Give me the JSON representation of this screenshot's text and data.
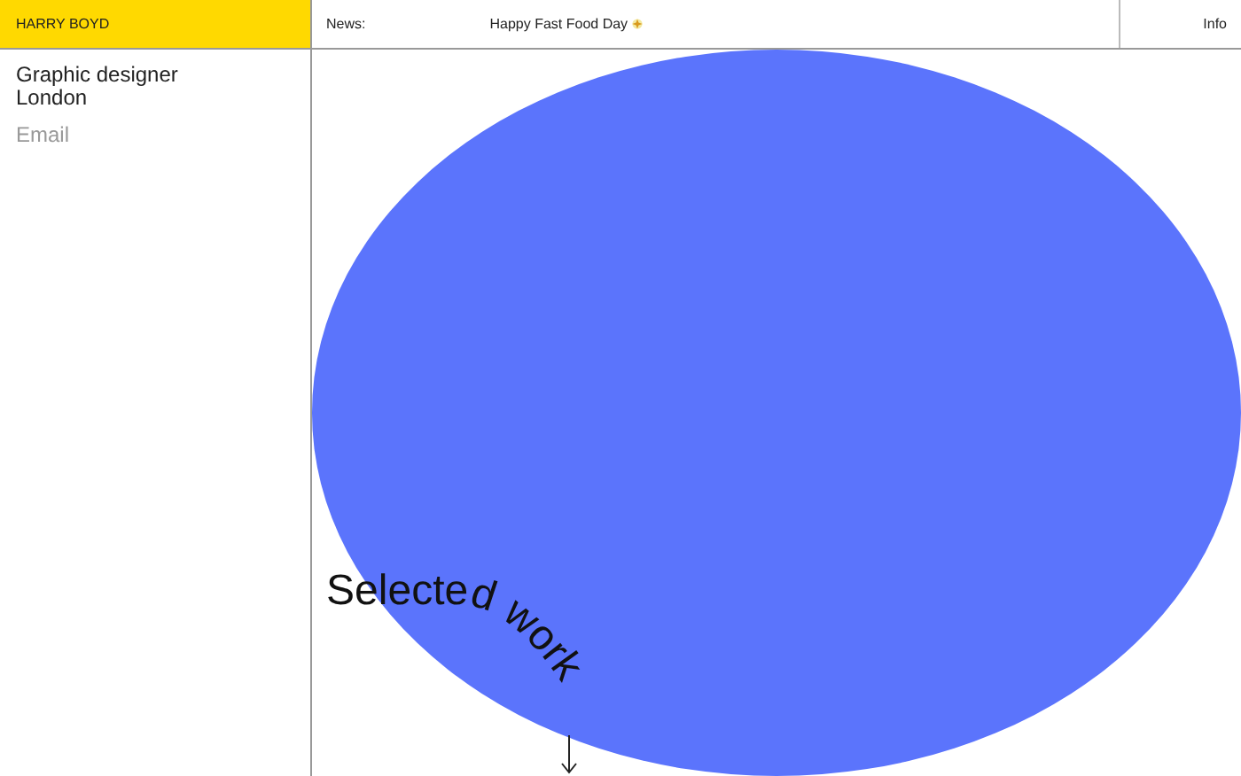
{
  "header": {
    "name": "HARRY BOYD",
    "news_label": "News:",
    "news_text": "Happy Fast Food Day",
    "info": "Info"
  },
  "sidebar": {
    "role": "Graphic designer",
    "location": "London",
    "email": "Email"
  },
  "heading": "Selected work"
}
